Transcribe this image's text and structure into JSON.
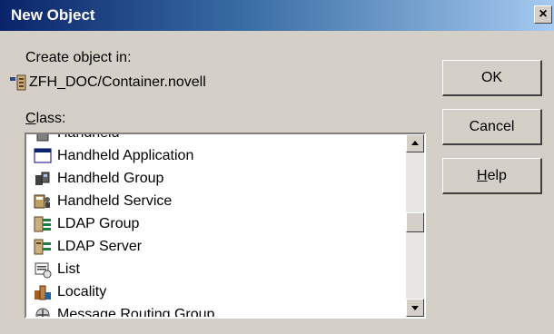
{
  "window": {
    "title": "New Object",
    "close_glyph": "×"
  },
  "create_in": {
    "label": "Create object in:",
    "path": "ZFH_DOC/Container.novell",
    "icon": "container-icon"
  },
  "class_list": {
    "label": "Class:",
    "items": [
      {
        "label": "Handheld",
        "icon": "handheld-icon"
      },
      {
        "label": "Handheld Application",
        "icon": "window-app-icon"
      },
      {
        "label": "Handheld Group",
        "icon": "group-icon"
      },
      {
        "label": "Handheld Service",
        "icon": "service-icon"
      },
      {
        "label": "LDAP Group",
        "icon": "ldap-group-icon"
      },
      {
        "label": "LDAP Server",
        "icon": "ldap-server-icon"
      },
      {
        "label": "List",
        "icon": "list-icon"
      },
      {
        "label": "Locality",
        "icon": "locality-icon"
      },
      {
        "label": "Message Routing Group",
        "icon": "message-routing-icon"
      }
    ]
  },
  "buttons": {
    "ok": "OK",
    "cancel": "Cancel",
    "help": "Help"
  }
}
